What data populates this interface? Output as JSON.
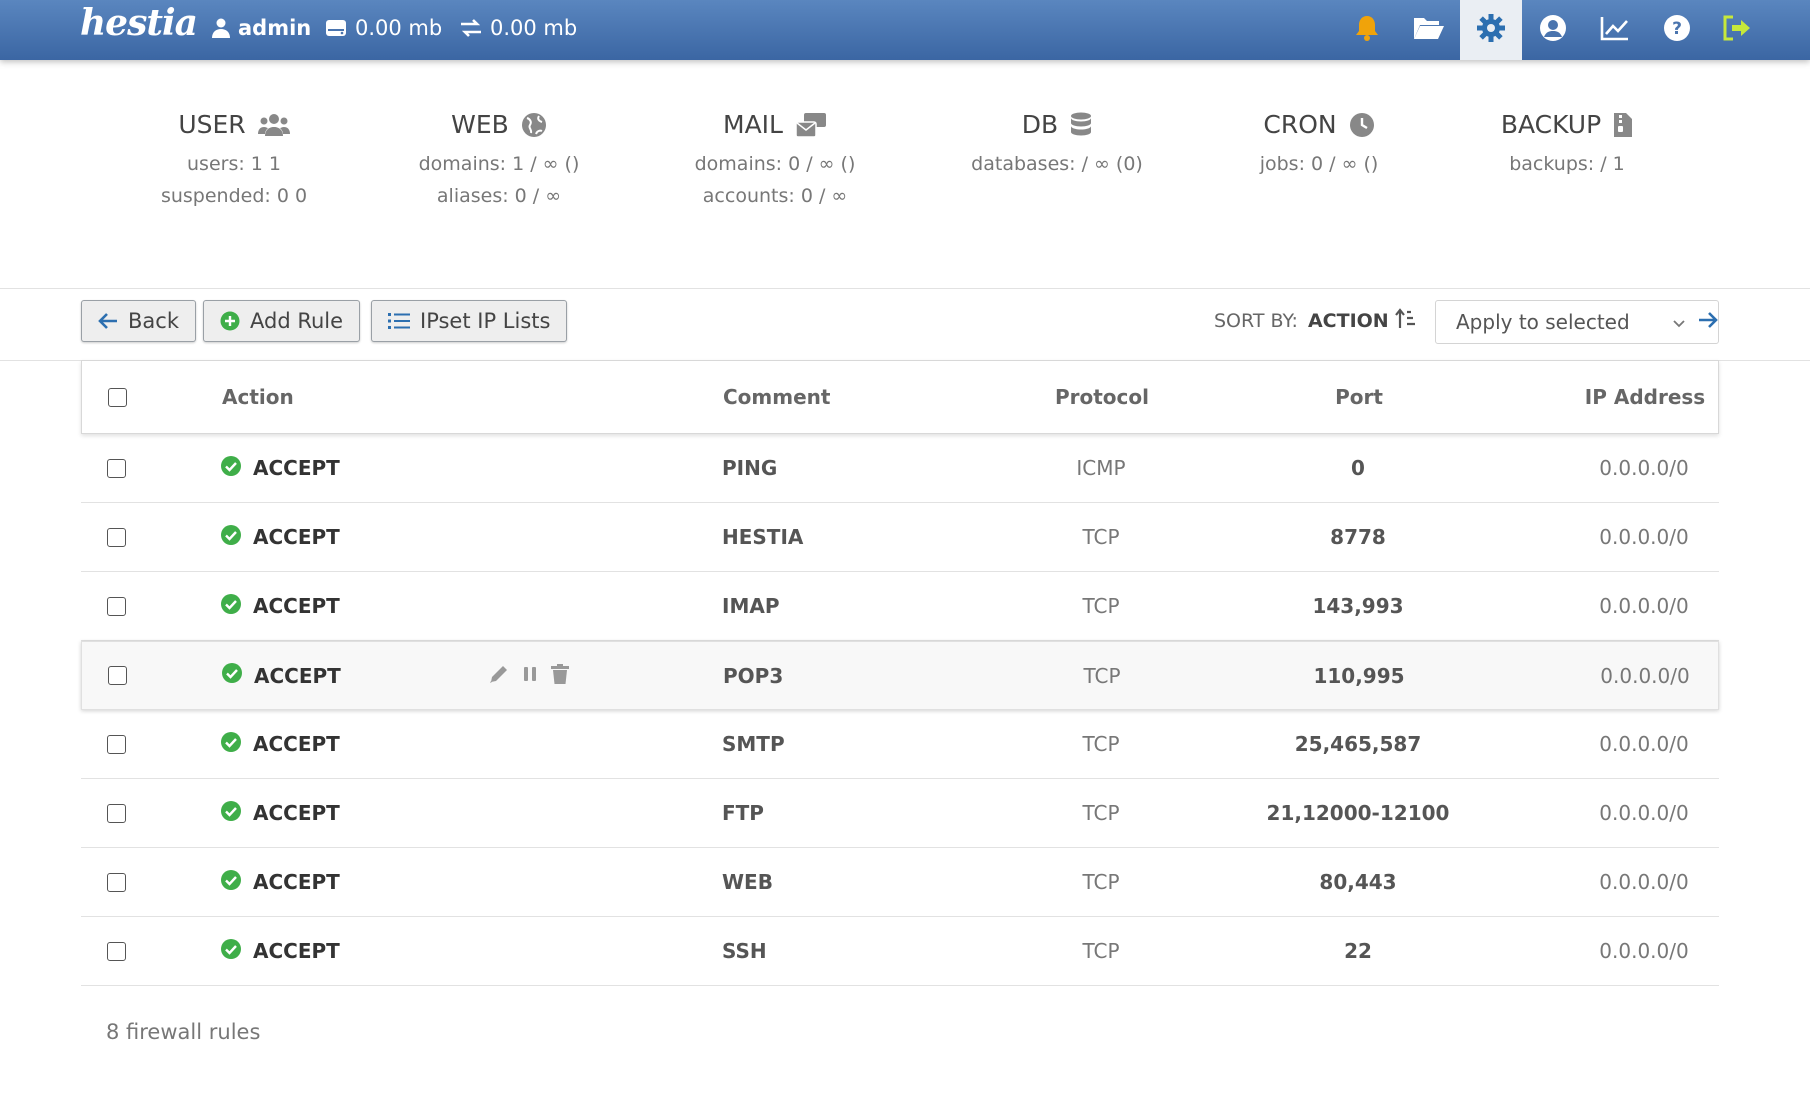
{
  "app": {
    "logo_text": "hestia",
    "user": "admin",
    "disk_usage": "0.00 mb",
    "bandwidth_usage": "0.00 mb"
  },
  "nav": {
    "icons": [
      "bell-icon",
      "folder-open-icon",
      "gear-icon",
      "user-circle-icon",
      "chart-line-icon",
      "question-circle-icon",
      "logout-icon"
    ],
    "active": "gear-icon",
    "logout_color": "#c6e83b"
  },
  "stats": {
    "user": {
      "title": "USER",
      "line1": "users: 1 1",
      "line2": "suspended: 0 0"
    },
    "web": {
      "title": "WEB",
      "line1": "domains: 1 / ∞ ()",
      "line2": "aliases: 0 / ∞"
    },
    "mail": {
      "title": "MAIL",
      "line1": "domains: 0 / ∞ ()",
      "line2": "accounts: 0 / ∞"
    },
    "db": {
      "title": "DB",
      "line1": "databases: / ∞ (0)"
    },
    "cron": {
      "title": "CRON",
      "line1": "jobs: 0 / ∞ ()"
    },
    "backup": {
      "title": "BACKUP",
      "line1": "backups: / 1"
    }
  },
  "toolbar": {
    "back_label": "Back",
    "add_rule_label": "Add Rule",
    "ipset_label": "IPset IP Lists",
    "sort_by_label": "SORT BY:",
    "sort_by_value": "ACTION",
    "bulk_placeholder": "Apply to selected"
  },
  "table": {
    "headers": {
      "action": "Action",
      "comment": "Comment",
      "protocol": "Protocol",
      "port": "Port",
      "ip": "IP Address"
    },
    "rows": [
      {
        "action": "ACCEPT",
        "comment": "PING",
        "protocol": "ICMP",
        "port": "0",
        "ip": "0.0.0.0/0"
      },
      {
        "action": "ACCEPT",
        "comment": "HESTIA",
        "protocol": "TCP",
        "port": "8778",
        "ip": "0.0.0.0/0"
      },
      {
        "action": "ACCEPT",
        "comment": "IMAP",
        "protocol": "TCP",
        "port": "143,993",
        "ip": "0.0.0.0/0"
      },
      {
        "action": "ACCEPT",
        "comment": "POP3",
        "protocol": "TCP",
        "port": "110,995",
        "ip": "0.0.0.0/0"
      },
      {
        "action": "ACCEPT",
        "comment": "SMTP",
        "protocol": "TCP",
        "port": "25,465,587",
        "ip": "0.0.0.0/0"
      },
      {
        "action": "ACCEPT",
        "comment": "FTP",
        "protocol": "TCP",
        "port": "21,12000-12100",
        "ip": "0.0.0.0/0"
      },
      {
        "action": "ACCEPT",
        "comment": "WEB",
        "protocol": "TCP",
        "port": "80,443",
        "ip": "0.0.0.0/0"
      },
      {
        "action": "ACCEPT",
        "comment": "SSH",
        "protocol": "TCP",
        "port": "22",
        "ip": "0.0.0.0/0"
      }
    ],
    "hovered_row": 3
  },
  "footer": {
    "count_text": "8 firewall rules"
  },
  "colors": {
    "header_gradient_top": "#5a86bf",
    "header_gradient_bottom": "#3b66a3",
    "accept_green": "#3fae49",
    "bell_orange": "#f0a30a",
    "add_green": "#3fae49",
    "link_blue": "#2c6fb0"
  }
}
